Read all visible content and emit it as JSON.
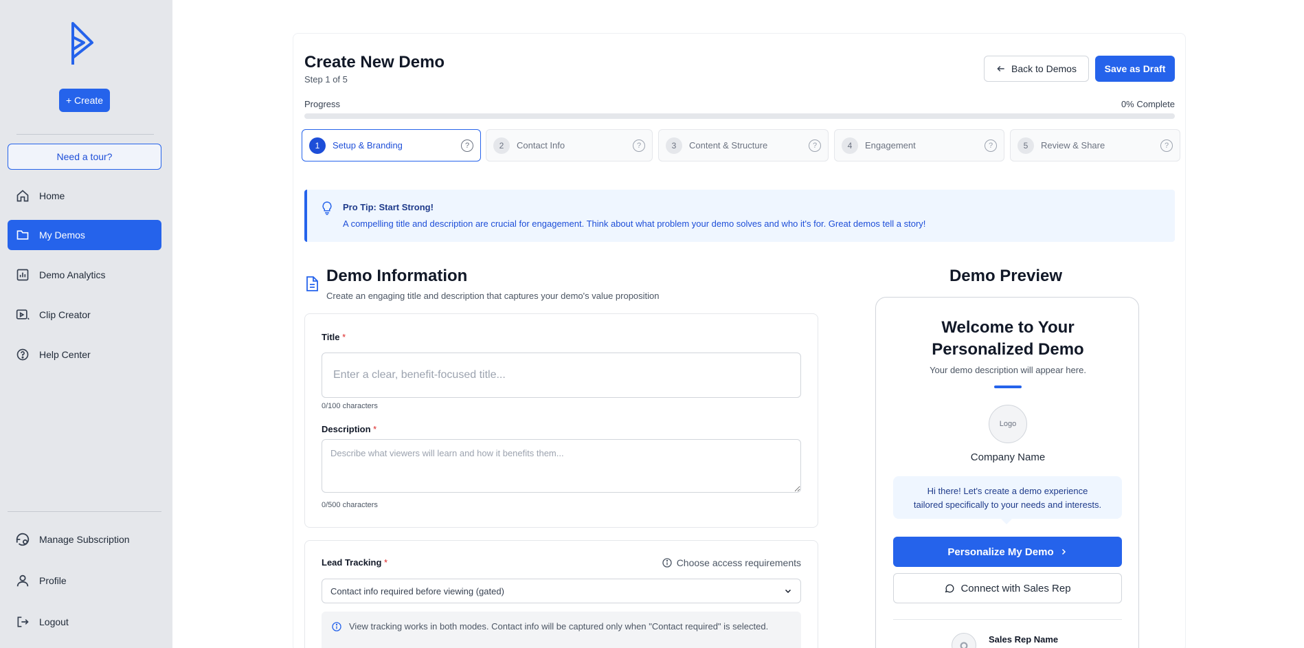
{
  "sidebar": {
    "create_label": "+ Create",
    "tour_label": "Need a tour?",
    "nav": [
      {
        "label": "Home",
        "icon": "home-icon",
        "active": false
      },
      {
        "label": "My Demos",
        "icon": "folder-icon",
        "active": true
      },
      {
        "label": "Demo Analytics",
        "icon": "chart-icon",
        "active": false
      },
      {
        "label": "Clip Creator",
        "icon": "video-icon",
        "active": false
      },
      {
        "label": "Help Center",
        "icon": "help-icon",
        "active": false
      }
    ],
    "bottom": [
      {
        "label": "Manage Subscription",
        "icon": "subscription-icon"
      },
      {
        "label": "Profile",
        "icon": "user-icon"
      },
      {
        "label": "Logout",
        "icon": "logout-icon"
      }
    ]
  },
  "header": {
    "title": "Create New Demo",
    "step": "Step 1 of 5",
    "back_label": "Back to Demos",
    "draft_label": "Save as Draft"
  },
  "progress": {
    "label": "Progress",
    "percent_text": "0% Complete",
    "value": 0
  },
  "steps": [
    {
      "num": "1",
      "label": "Setup & Branding",
      "active": true
    },
    {
      "num": "2",
      "label": "Contact Info",
      "active": false
    },
    {
      "num": "3",
      "label": "Content & Structure",
      "active": false
    },
    {
      "num": "4",
      "label": "Engagement",
      "active": false
    },
    {
      "num": "5",
      "label": "Review & Share",
      "active": false
    }
  ],
  "tip": {
    "title": "Pro Tip: Start Strong!",
    "text": "A compelling title and description are crucial for engagement. Think about what problem your demo solves and who it's for. Great demos tell a story!"
  },
  "demo_info": {
    "title": "Demo Information",
    "subtitle": "Create an engaging title and description that captures your demo's value proposition",
    "title_label": "Title",
    "title_placeholder": "Enter a clear, benefit-focused title...",
    "title_counter": "0/100 characters",
    "desc_label": "Description",
    "desc_placeholder": "Describe what viewers will learn and how it benefits them...",
    "desc_counter": "0/500 characters",
    "required_mark": "*"
  },
  "lead": {
    "label": "Lead Tracking",
    "hint": "Choose access requirements",
    "selected": "Contact info required before viewing (gated)",
    "note": "View tracking works in both modes. Contact info will be captured only when \"Contact required\" is selected."
  },
  "preview": {
    "title": "Demo Preview",
    "welcome": "Welcome to Your Personalized Demo",
    "description": "Your demo description will appear here.",
    "logo_text": "Logo",
    "company": "Company Name",
    "bubble": "Hi there! Let's create a demo experience tailored specifically to your needs and interests.",
    "personalize_label": "Personalize My Demo",
    "connect_label": "Connect with Sales Rep",
    "rep_name": "Sales Rep Name",
    "accent_color": "#2563eb"
  }
}
